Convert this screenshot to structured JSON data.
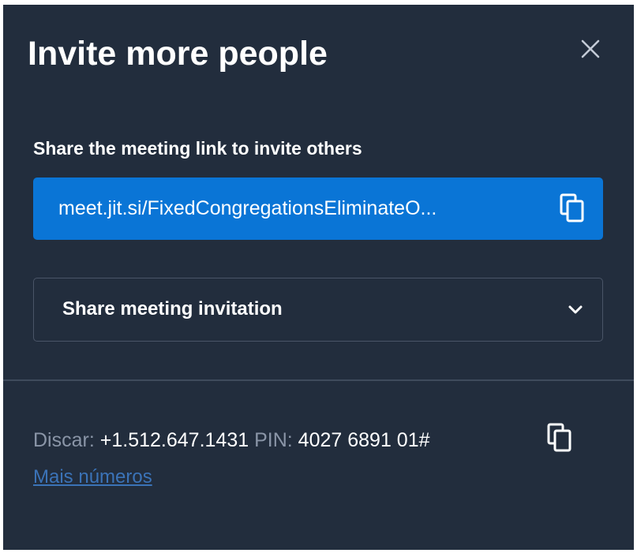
{
  "dialog": {
    "title": "Invite more people",
    "close_icon": "close-icon"
  },
  "share_link": {
    "label": "Share the meeting link to invite others",
    "url": "meet.jit.si/FixedCongregationsEliminateO...",
    "copy_icon": "copy-icon"
  },
  "share_invitation": {
    "label": "Share meeting invitation",
    "icon": "chevron-down-icon"
  },
  "dial_in": {
    "dial_label": "Discar:",
    "phone": "+1.512.647.1431",
    "pin_label": "PIN:",
    "pin": "4027 6891 01#",
    "copy_icon": "copy-icon",
    "more_numbers": "Mais números"
  },
  "colors": {
    "background": "#222d3d",
    "accent": "#0a75d6",
    "link": "#3b73b8",
    "muted_text": "#8a95a7"
  }
}
